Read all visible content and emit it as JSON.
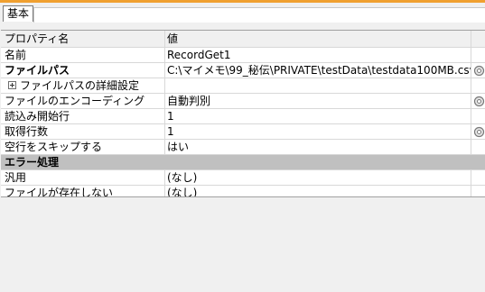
{
  "tab": {
    "label": "基本"
  },
  "header": {
    "name_col": "プロパティ名",
    "value_col": "値"
  },
  "rows": [
    {
      "name": "名前",
      "value": "RecordGet1"
    },
    {
      "name": "ファイルパス",
      "value": "C:\\マイメモ\\99_秘伝\\PRIVATE\\testData\\testdata100MB.csv"
    },
    {
      "name": "ファイルパスの詳細設定",
      "value": ""
    },
    {
      "name": "ファイルのエンコーディング",
      "value": "自動判別"
    },
    {
      "name": "読込み開始行",
      "value": "1"
    },
    {
      "name": "取得行数",
      "value": "1"
    },
    {
      "name": "空行をスキップする",
      "value": "はい"
    }
  ],
  "section": {
    "label": "エラー処理"
  },
  "error_rows": [
    {
      "name": "汎用",
      "value": "(なし)"
    },
    {
      "name": "ファイルが存在しない",
      "value": "(なし)"
    }
  ],
  "icons": {
    "edit": "gear-icon",
    "expand": "plus-box-icon"
  }
}
